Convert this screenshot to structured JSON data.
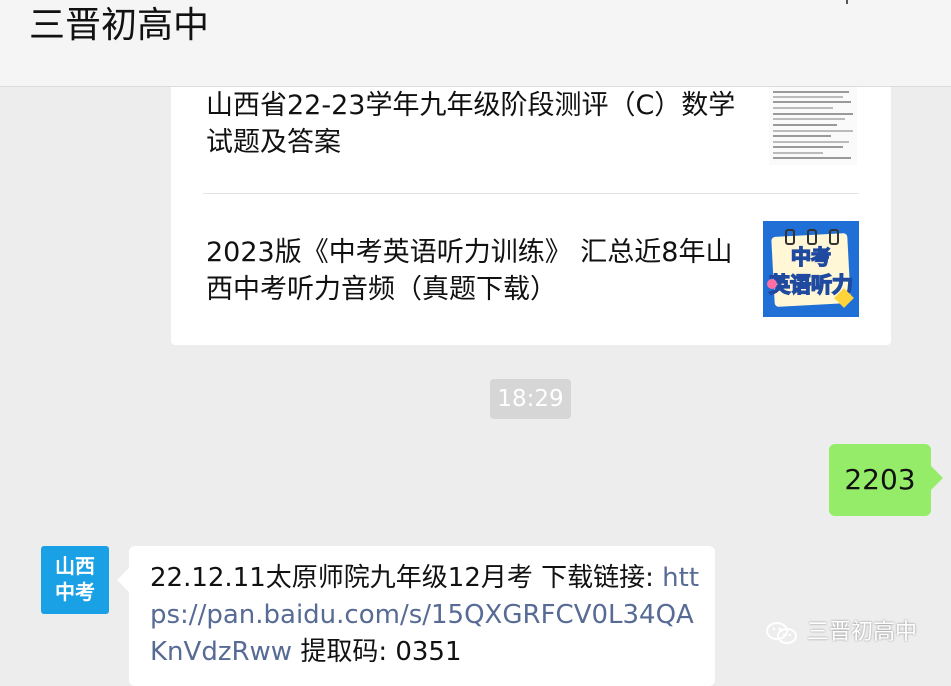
{
  "header": {
    "title": "三晋初高中"
  },
  "articles": [
    {
      "title": "山西省22-23学年九年级阶段测评（C）数学试题及答案",
      "thumbnail": "document-scan-thumbnail"
    },
    {
      "title": "2023版《中考英语听力训练》 汇总近8年山西中考听力音频（真题下载）",
      "thumbnail": "english-listening-thumbnail",
      "thumb_line1": "中考",
      "thumb_line2": "英语听力"
    }
  ],
  "timestamp": "18:29",
  "my_message": "2203",
  "reply": {
    "avatar_line1": "山西",
    "avatar_line2": "中考",
    "text_prefix": "22.12.11太原师院九年级12月考 下载链接: ",
    "link": "https://pan.baidu.com/s/15QXGRFCV0L34QAKnVdzRww",
    "text_suffix": " 提取码: 0351"
  },
  "watermark": {
    "label": "三晋初高中",
    "icon": "wechat-icon"
  },
  "colors": {
    "my_bubble": "#95ec69",
    "link": "#576b95",
    "avatar": "#1aa0e4",
    "background": "#ededed"
  }
}
